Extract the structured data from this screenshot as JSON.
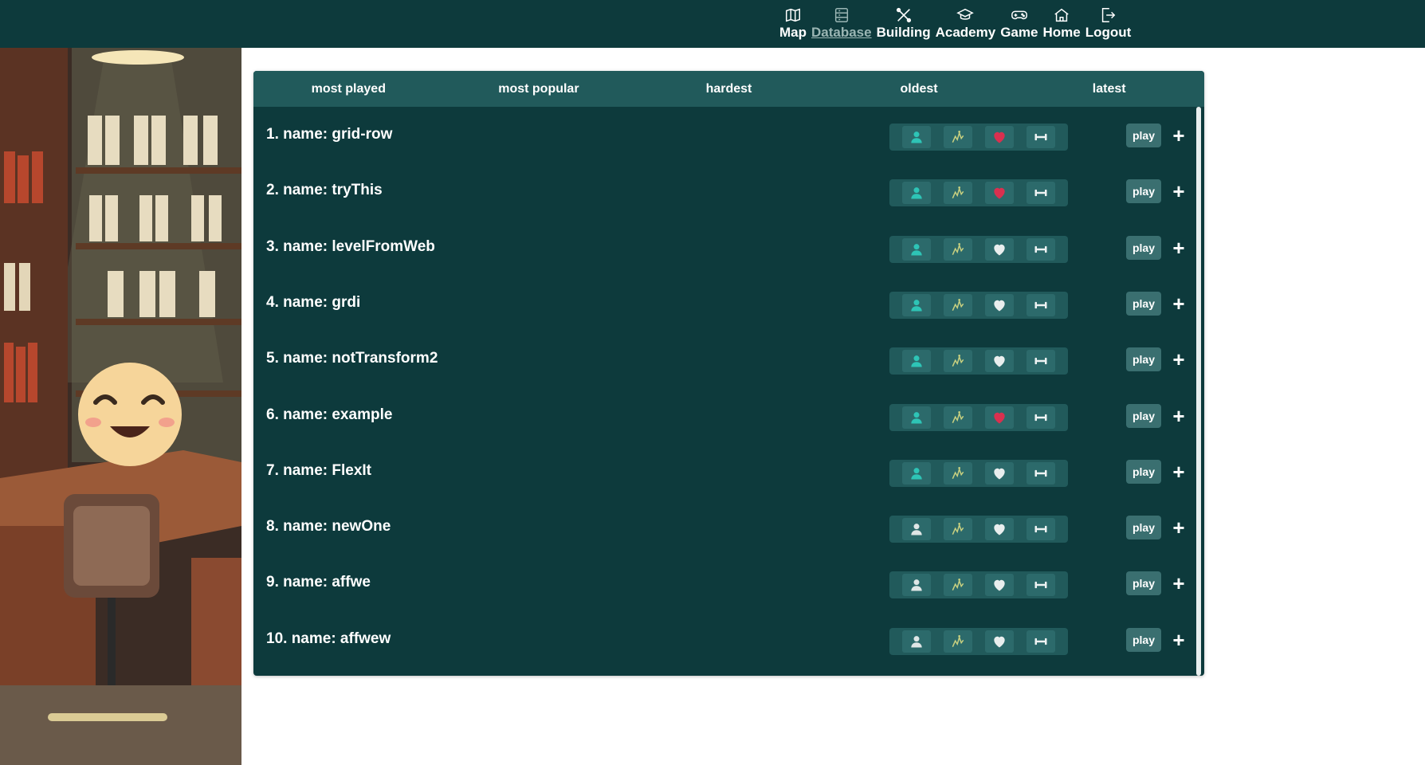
{
  "nav": {
    "items": [
      {
        "label": "Map",
        "icon": "map-icon",
        "active": false
      },
      {
        "label": "Database",
        "icon": "database-icon",
        "active": true
      },
      {
        "label": "Building",
        "icon": "tools-icon",
        "active": false
      },
      {
        "label": "Academy",
        "icon": "graduation-cap-icon",
        "active": false
      },
      {
        "label": "Game",
        "icon": "gamepad-icon",
        "active": false
      },
      {
        "label": "Home",
        "icon": "home-icon",
        "active": false
      },
      {
        "label": "Logout",
        "icon": "logout-icon",
        "active": false
      }
    ]
  },
  "tabs": [
    "most played",
    "most popular",
    "hardest",
    "oldest",
    "latest"
  ],
  "colors": {
    "background": "#0d3a3c",
    "header": "#215a5b",
    "user_active": "#2ec4b6",
    "user_inactive": "#dfe6e6",
    "heart_liked": "#d9304f",
    "heart_unliked": "#e9eeee",
    "difficulty_icon": "#c8d080"
  },
  "levels": [
    {
      "name": "1. name: grid-row",
      "user_highlight": true,
      "liked": true,
      "play": "play",
      "add": "+"
    },
    {
      "name": "2. name: tryThis",
      "user_highlight": true,
      "liked": true,
      "play": "play",
      "add": "+"
    },
    {
      "name": "3. name: levelFromWeb",
      "user_highlight": true,
      "liked": false,
      "play": "play",
      "add": "+"
    },
    {
      "name": "4. name: grdi",
      "user_highlight": true,
      "liked": false,
      "play": "play",
      "add": "+"
    },
    {
      "name": "5. name: notTransform2",
      "user_highlight": true,
      "liked": false,
      "play": "play",
      "add": "+"
    },
    {
      "name": "6. name: example",
      "user_highlight": true,
      "liked": true,
      "play": "play",
      "add": "+"
    },
    {
      "name": "7. name: FlexIt",
      "user_highlight": true,
      "liked": false,
      "play": "play",
      "add": "+"
    },
    {
      "name": "8. name: newOne",
      "user_highlight": false,
      "liked": false,
      "play": "play",
      "add": "+"
    },
    {
      "name": "9. name: affwe",
      "user_highlight": false,
      "liked": false,
      "play": "play",
      "add": "+"
    },
    {
      "name": "10. name: affwew",
      "user_highlight": false,
      "liked": false,
      "play": "play",
      "add": "+"
    }
  ]
}
